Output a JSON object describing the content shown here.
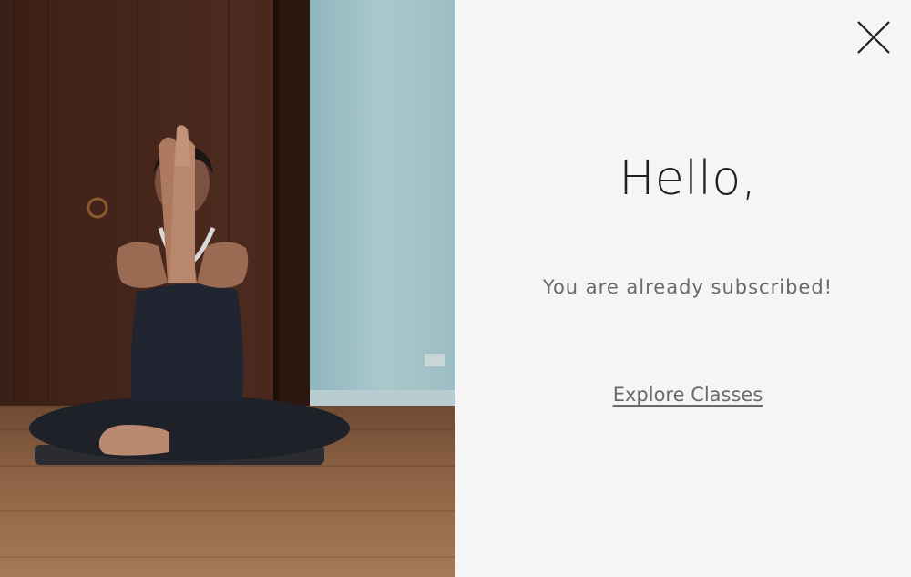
{
  "modal": {
    "title": "Hello,",
    "message": "You are already subscribed!",
    "cta_label": "Explore Classes",
    "close_icon": "close-icon"
  },
  "photo": {
    "subject": "yoga-meditation-photo"
  },
  "colors": {
    "panel_bg": "#f5f5f5",
    "title_text": "#1f1f1f",
    "body_text": "#6a6a6a"
  }
}
